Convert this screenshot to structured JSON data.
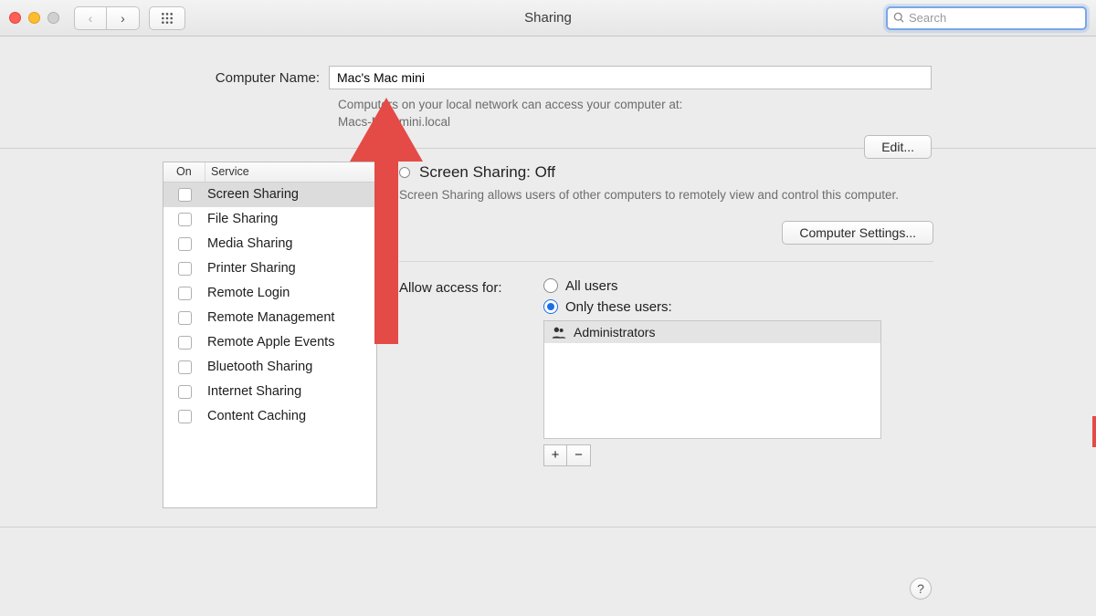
{
  "window": {
    "title": "Sharing"
  },
  "search": {
    "placeholder": "Search"
  },
  "computer_name": {
    "label": "Computer Name:",
    "value": "Mac's Mac mini",
    "note_line1": "Computers on your local network can access your computer at:",
    "note_line2": "Macs-Mac-mini.local",
    "edit_button": "Edit..."
  },
  "services": {
    "columns": {
      "on": "On",
      "service": "Service"
    },
    "items": [
      {
        "label": "Screen Sharing",
        "on": false,
        "selected": true
      },
      {
        "label": "File Sharing",
        "on": false,
        "selected": false
      },
      {
        "label": "Media Sharing",
        "on": false,
        "selected": false
      },
      {
        "label": "Printer Sharing",
        "on": false,
        "selected": false
      },
      {
        "label": "Remote Login",
        "on": false,
        "selected": false
      },
      {
        "label": "Remote Management",
        "on": false,
        "selected": false
      },
      {
        "label": "Remote Apple Events",
        "on": false,
        "selected": false
      },
      {
        "label": "Bluetooth Sharing",
        "on": false,
        "selected": false
      },
      {
        "label": "Internet Sharing",
        "on": false,
        "selected": false
      },
      {
        "label": "Content Caching",
        "on": false,
        "selected": false
      }
    ]
  },
  "detail": {
    "status_title": "Screen Sharing: Off",
    "description": "Screen Sharing allows users of other computers to remotely view and control this computer.",
    "computer_settings_button": "Computer Settings...",
    "access_label": "Allow access for:",
    "radio_all_users": "All users",
    "radio_only_these": "Only these users:",
    "users": [
      "Administrators"
    ],
    "add_label": "+",
    "remove_label": "−"
  },
  "help": {
    "label": "?"
  },
  "annotation": {
    "arrow_color": "#e44b46"
  }
}
